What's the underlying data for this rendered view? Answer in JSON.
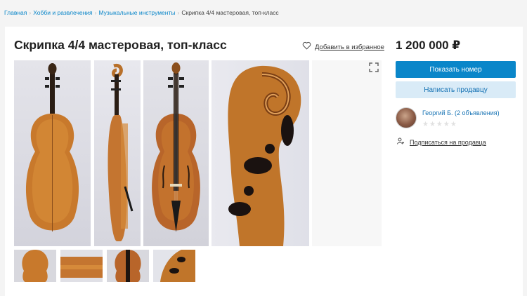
{
  "breadcrumbs": {
    "items": [
      "Главная",
      "Хобби и развлечения",
      "Музыкальные инструменты"
    ],
    "current": "Скрипка 4/4 мастеровая, топ-класс"
  },
  "listing": {
    "title": "Скрипка 4/4 мастеровая, топ-класс",
    "favorite_label": "Добавить в избранное",
    "price": "1 200 000 ₽"
  },
  "actions": {
    "show_phone": "Показать номер",
    "write_seller": "Написать продавцу",
    "subscribe": "Подписаться на продавца"
  },
  "seller": {
    "name": "Георгий Б. (2 объявления)",
    "stars": "★★★★★"
  },
  "colors": {
    "accent": "#0a86c9",
    "secondary_bg": "#d9ebf7",
    "wood": "#c0752a"
  },
  "icons": {
    "favorite": "heart-icon",
    "expand": "fullscreen-icon",
    "subscribe": "user-plus-icon"
  }
}
